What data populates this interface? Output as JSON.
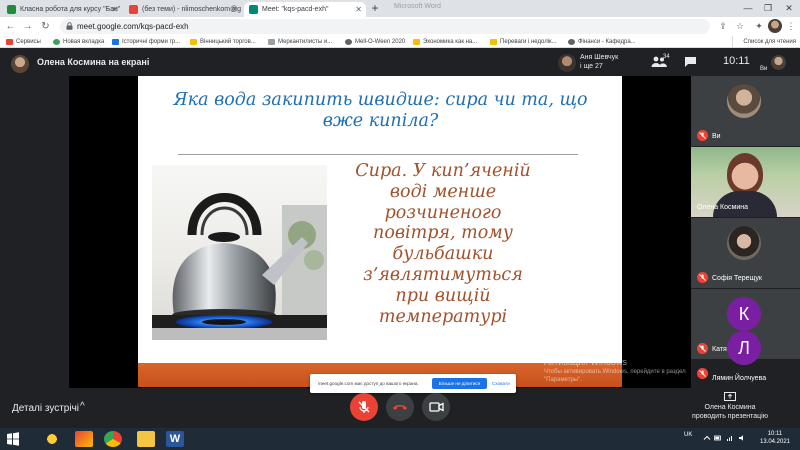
{
  "browser": {
    "tabs": [
      {
        "label": "Класна робота для курсу \"Бан\"",
        "favicon": "classroom-icon",
        "color": "#1e8e3e"
      },
      {
        "label": "(без теми) - nlimoschenkom@g",
        "favicon": "gmail-icon",
        "color": "#ea4335"
      },
      {
        "label": "Meet: \"kqs-pacd-exh\"",
        "favicon": "meet-icon",
        "color": "#00897b"
      }
    ],
    "new_tab_glyph": "+",
    "window_title": "Microsoft Word",
    "window_controls": {
      "minimize": "—",
      "maximize": "❐",
      "close": "✕"
    },
    "nav": {
      "back": "←",
      "forward": "→",
      "reload": "↻"
    },
    "url": "meet.google.com/kqs-pacd-exh",
    "toolbar_icons": {
      "share": "⇪",
      "star": "☆",
      "extensions": "✦"
    },
    "bookmarks": [
      "Сервисы",
      "Новая вкладка",
      "Історичні форми гр...",
      "Вінницький торгов...",
      "Меркантилисты и...",
      "Mell-O-Ween 2020",
      "Экономика как на...",
      "Переваги і недолік...",
      "Фінанси - Кафедра..."
    ],
    "reading_list": "Список для чтения"
  },
  "meet": {
    "presenting_title": "Олена Космина на екрані",
    "pinned": {
      "name": "Аня Шевчук",
      "sub": "і ще 27"
    },
    "people_count": "34",
    "clock": "10:11",
    "self_mini_label": "Ви",
    "slide": {
      "title": "Яка вода закипить швидше: сира чи та, що вже кипіла?",
      "answer": "Сира. У кип’яченій воді менше розчиненого повітря, тому бульбашки з’являтимуться при вищій температурі",
      "title_color": "#1f6fb2",
      "answer_color": "#a0522d",
      "footer_color": "#d45a25"
    },
    "share_banner": {
      "text": "meet.google.com має доступ до вашого екрана.",
      "stop": "Більше не ділитися",
      "hide": "Сховати"
    },
    "watermark": {
      "title": "Активация Windows",
      "subtitle": "Чтобы активировать Windows, перейдите в раздел \"Параметры\"."
    },
    "participants": [
      {
        "name": "Ви",
        "muted": true,
        "kind": "photo"
      },
      {
        "name": "Олена Космина",
        "muted": false,
        "kind": "video"
      },
      {
        "name": "Софія Терещук",
        "muted": true,
        "kind": "photo"
      },
      {
        "name": "Катя Віцькова",
        "muted": true,
        "kind": "letter",
        "letter": "К",
        "color": "#7b1fa2"
      },
      {
        "name": "Лямин Йолчуева",
        "muted": true,
        "kind": "letter",
        "letter": "Л",
        "color": "#7b1fa2"
      }
    ],
    "details": "Деталі зустрічі",
    "details_chevron": "^",
    "presenter_label": "Олена Космина проводить презентацію"
  },
  "taskbar": {
    "lang": "UK",
    "time": "10:11",
    "date": "13.04.2021"
  }
}
